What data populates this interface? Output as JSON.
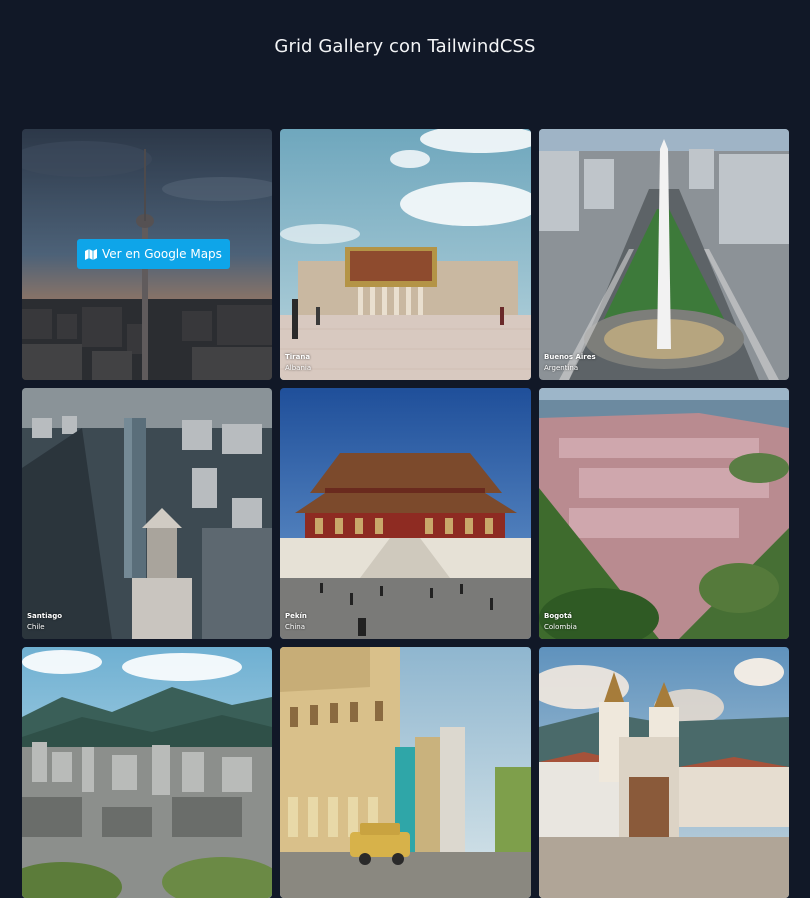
{
  "page": {
    "title": "Grid Gallery con TailwindCSS"
  },
  "hovered_card": {
    "button_label": "Ver en Google Maps",
    "button_icon": "map-icon"
  },
  "accent_color": "#0ea5e9",
  "gallery": [
    {
      "city": "",
      "country": ""
    },
    {
      "city": "Tirana",
      "country": "Albania"
    },
    {
      "city": "Buenos Aires",
      "country": "Argentina"
    },
    {
      "city": "Santiago",
      "country": "Chile"
    },
    {
      "city": "Pekín",
      "country": "China"
    },
    {
      "city": "Bogotá",
      "country": "Colombia"
    },
    {
      "city": "",
      "country": ""
    },
    {
      "city": "",
      "country": ""
    },
    {
      "city": "",
      "country": ""
    }
  ]
}
